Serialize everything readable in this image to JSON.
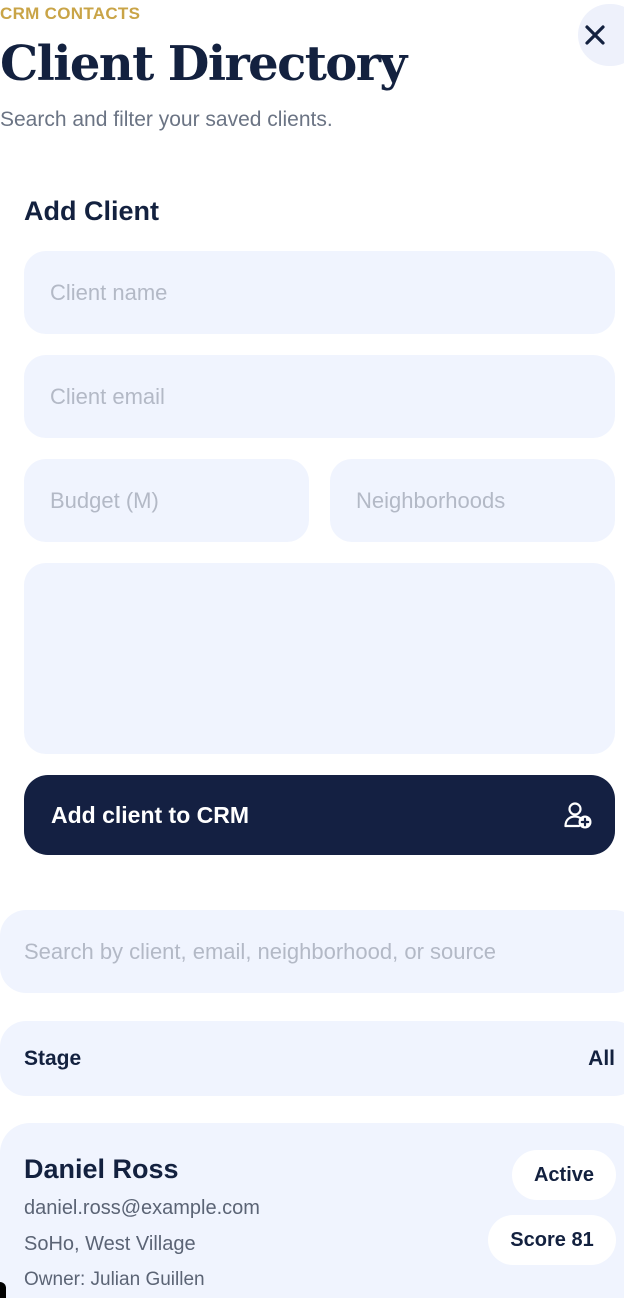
{
  "header": {
    "eyebrow": "CRM CONTACTS",
    "title": "Client Directory",
    "subtitle": "Search and filter your saved clients."
  },
  "close": {
    "icon": "close-icon"
  },
  "add_client": {
    "title": "Add Client",
    "name_placeholder": "Client name",
    "email_placeholder": "Client email",
    "budget_placeholder": "Budget (M)",
    "neighborhoods_placeholder": "Neighborhoods",
    "notes_placeholder": "",
    "submit_label": "Add client to CRM",
    "submit_icon": "user-plus-icon"
  },
  "search": {
    "placeholder": "Search by client, email, neighborhood, or source"
  },
  "filter": {
    "label": "Stage",
    "value": "All"
  },
  "clients": [
    {
      "name": "Daniel Ross",
      "email": "daniel.ross@example.com",
      "neighborhoods": "SoHo, West Village",
      "owner": "Owner: Julian Guillen",
      "status": "Active",
      "score": "Score 81"
    }
  ],
  "colors": {
    "accent": "#c9a447",
    "navy": "#142042",
    "field_bg": "#f0f4fe"
  }
}
